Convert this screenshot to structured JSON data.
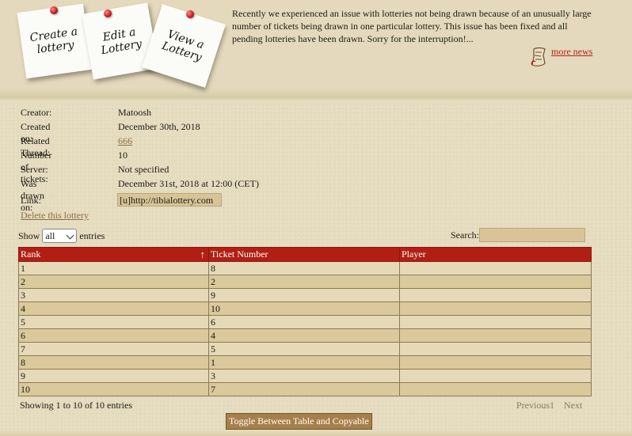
{
  "notes": {
    "create": "Create a lottery",
    "edit": "Edit a Lottery",
    "view": "View a Lottery"
  },
  "news": {
    "text": "Recently we experienced an issue with lotteries not being drawn because of an unusually large number of tickets being drawn in one particular lottery. This issue has been fixed and all pending lotteries have been drawn. Sorry for the interruption!...",
    "more_label": "more news",
    "icon": "scroll-icon"
  },
  "details": {
    "creator_label": "Creator:",
    "creator": "Matoosh",
    "created_on_label": "Created on:",
    "created_on": "December 30th, 2018",
    "thread_label": "Related Thread:",
    "thread": "666",
    "tickets_label": "Number of tickets:",
    "tickets": "10",
    "server_label": "Server:",
    "server": "Not specified",
    "drawn_label": "Was drawn on:",
    "drawn": "December 31st, 2018 at 12:00 (CET)",
    "link_label": "Link:",
    "link": "[u]http://tibialottery.com",
    "delete_label": "Delete this lottery"
  },
  "controls": {
    "show_label": "Show",
    "entries_label": "entries",
    "selected": "all",
    "search_label": "Search:"
  },
  "table": {
    "columns": [
      "Rank",
      "Ticket Number",
      "Player"
    ],
    "rows": [
      [
        "1",
        "8",
        ""
      ],
      [
        "2",
        "2",
        ""
      ],
      [
        "3",
        "9",
        ""
      ],
      [
        "4",
        "10",
        ""
      ],
      [
        "5",
        "6",
        ""
      ],
      [
        "6",
        "4",
        ""
      ],
      [
        "7",
        "5",
        ""
      ],
      [
        "8",
        "1",
        ""
      ],
      [
        "9",
        "3",
        ""
      ],
      [
        "10",
        "7",
        ""
      ]
    ],
    "sort_indicator": "↑"
  },
  "footer": {
    "info": "Showing 1 to 10 of 10 entries",
    "previous": "Previous",
    "page": "1",
    "next": "Next",
    "toggle_label": "Toggle Between Table and Copyable"
  },
  "colors": {
    "header_red": "#b21e14",
    "link_red": "#b3241b",
    "button_brown": "#a6804a"
  }
}
